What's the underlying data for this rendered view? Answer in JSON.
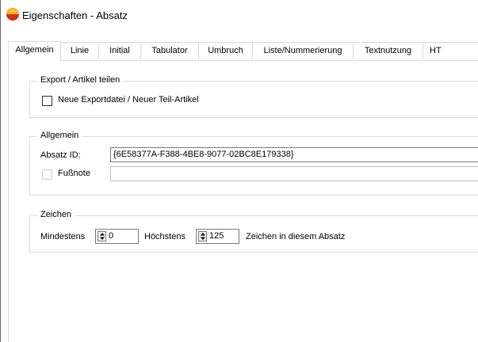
{
  "window": {
    "title": "Eigenschaften - Absatz",
    "icon": "app-logo-icon"
  },
  "tabs": [
    {
      "label": "Allgemein",
      "active": true
    },
    {
      "label": "Linie"
    },
    {
      "label": "Initial"
    },
    {
      "label": "Tabulator"
    },
    {
      "label": "Umbruch"
    },
    {
      "label": "Liste/Nummerierung"
    },
    {
      "label": "Textnutzung"
    },
    {
      "label": "HT"
    }
  ],
  "export_group": {
    "legend": "Export / Artikel teilen",
    "new_export_label": "Neue Exportdatei / Neuer Teil-Artikel",
    "new_export_checked": false
  },
  "general_group": {
    "legend": "Allgemein",
    "paragraph_id_label": "Absatz ID:",
    "paragraph_id_value": "{6E58377A-F388-4BE8-9077-02BC8E179338}",
    "footnote_label": "Fußnote",
    "footnote_checked": false,
    "footnote_value": ""
  },
  "chars_group": {
    "legend": "Zeichen",
    "min_label": "Mindestens",
    "min_value": "0",
    "max_label": "Höchstens",
    "max_value": "125",
    "suffix_label": "Zeichen in diesem Absatz"
  },
  "colors": {
    "border": "#d9d9d9",
    "input_border": "#7a7a7a"
  }
}
